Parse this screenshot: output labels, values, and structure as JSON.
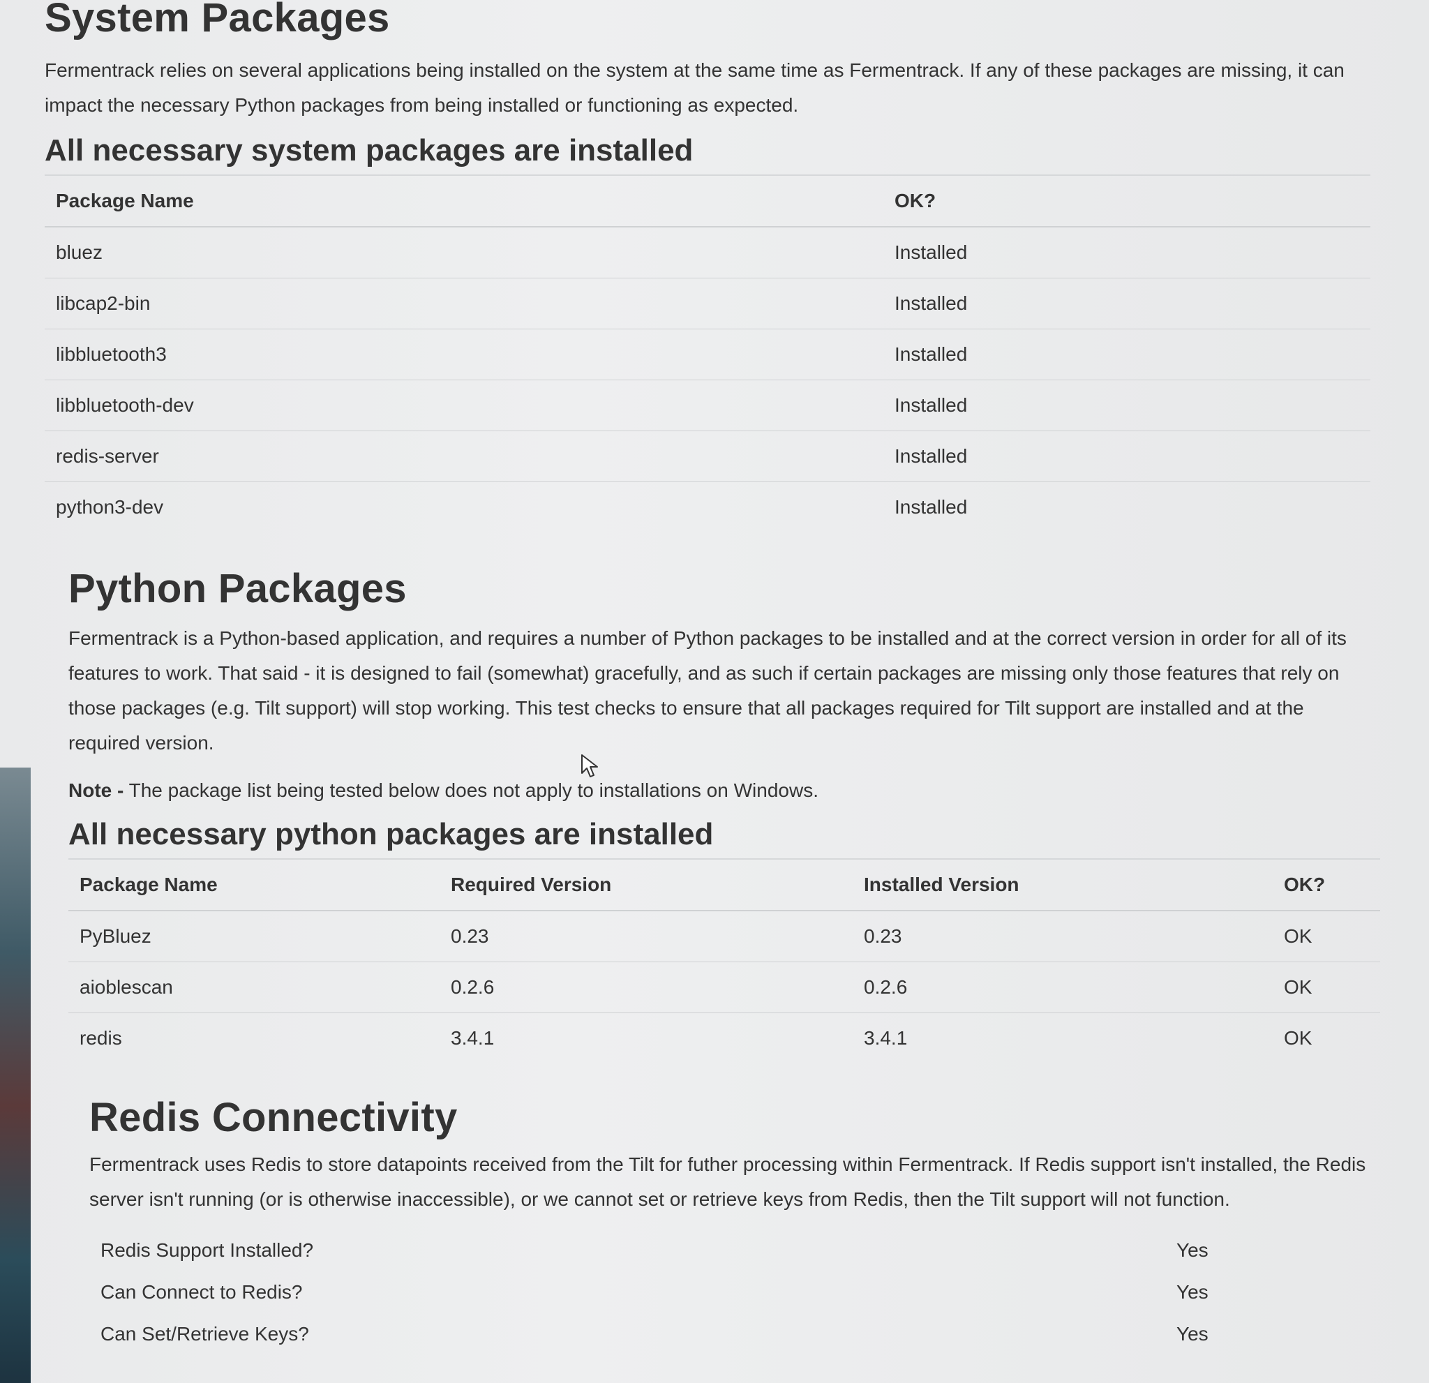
{
  "system_packages": {
    "title": "System Packages",
    "description": "Fermentrack relies on several applications being installed on the system at the same time as Fermentrack. If any of these packages are missing, it can impact the necessary Python packages from being installed or functioning as expected.",
    "status": "All necessary system packages are installed",
    "columns": [
      "Package Name",
      "OK?"
    ],
    "rows": [
      [
        "bluez",
        "Installed"
      ],
      [
        "libcap2-bin",
        "Installed"
      ],
      [
        "libbluetooth3",
        "Installed"
      ],
      [
        "libbluetooth-dev",
        "Installed"
      ],
      [
        "redis-server",
        "Installed"
      ],
      [
        "python3-dev",
        "Installed"
      ]
    ]
  },
  "python_packages": {
    "title": "Python Packages",
    "description": "Fermentrack is a Python-based application, and requires a number of Python packages to be installed and at the correct version in order for all of its features to work. That said - it is designed to fail (somewhat) gracefully, and as such if certain packages are missing only those features that rely on those packages (e.g. Tilt support) will stop working. This test checks to ensure that all packages required for Tilt support are installed and at the required version.",
    "note_label": "Note -",
    "note_text": " The package list being tested below does not apply to installations on Windows.",
    "status": "All necessary python packages are installed",
    "columns": [
      "Package Name",
      "Required Version",
      "Installed Version",
      "OK?"
    ],
    "rows": [
      [
        "PyBluez",
        "0.23",
        "0.23",
        "OK"
      ],
      [
        "aioblescan",
        "0.2.6",
        "0.2.6",
        "OK"
      ],
      [
        "redis",
        "3.4.1",
        "3.4.1",
        "OK"
      ]
    ]
  },
  "redis": {
    "title": "Redis Connectivity",
    "description": "Fermentrack uses Redis to store datapoints received from the Tilt for futher processing within Fermentrack. If Redis support isn't installed, the Redis server isn't running (or is otherwise inaccessible), or we cannot set or retrieve keys from Redis, then the Tilt support will not function.",
    "checks": [
      [
        "Redis Support Installed?",
        "Yes"
      ],
      [
        "Can Connect to Redis?",
        "Yes"
      ],
      [
        "Can Set/Retrieve Keys?",
        "Yes"
      ]
    ]
  },
  "icons": {
    "cursor": "mouse-pointer-icon"
  }
}
